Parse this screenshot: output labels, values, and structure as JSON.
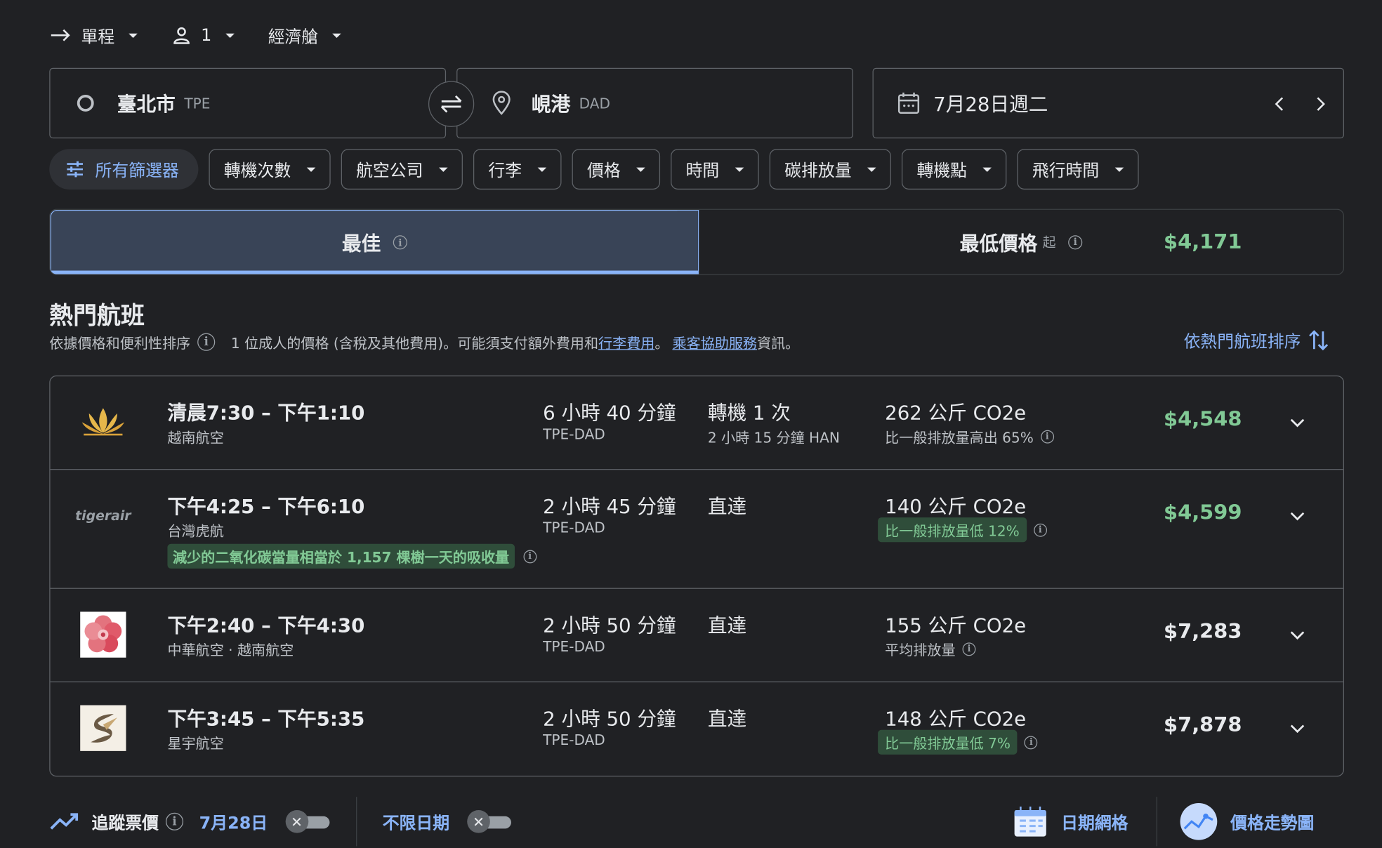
{
  "topbar": {
    "trip_type": "單程",
    "passengers": "1",
    "cabin": "經濟艙"
  },
  "search": {
    "origin_city": "臺北市",
    "origin_code": "TPE",
    "dest_city": "峴港",
    "dest_code": "DAD",
    "date": "7月28日週二"
  },
  "filters": {
    "all": "所有篩選器",
    "chips": [
      "轉機次數",
      "航空公司",
      "行李",
      "價格",
      "時間",
      "碳排放量",
      "轉機點",
      "飛行時間"
    ]
  },
  "tabs": {
    "best": "最佳",
    "cheapest": "最低價格",
    "cheapest_price": "$4,171",
    "cheapest_from": "起"
  },
  "section": {
    "title": "熱門航班",
    "sort_note": "依據價格和便利性排序",
    "price_note": "1 位成人的價格 (含稅及其他費用)。可能須支付額外費用和",
    "baggage_link": "行李費用",
    "sep": "。",
    "assist_link": "乘客協助服務",
    "tail": "資訊。",
    "sort_button": "依熱門航班排序"
  },
  "flights": [
    {
      "times": "清晨7:30 – 下午1:10",
      "airline": "越南航空",
      "duration": "6 小時 40 分鐘",
      "route": "TPE-DAD",
      "stops": "轉機 1 次",
      "layover": "2 小時 15 分鐘 HAN",
      "co2": "262 公斤 CO2e",
      "co2_note": "比一般排放量高出 65%",
      "price": "$4,548",
      "logo": "lotus-logo-icon"
    },
    {
      "times": "下午4:25 – 下午6:10",
      "airline": "台灣虎航",
      "duration": "2 小時 45 分鐘",
      "route": "TPE-DAD",
      "stops": "直達",
      "co2": "140 公斤 CO2e",
      "co2_note": "比一般排放量低 12%",
      "eco_badge": "減少的二氧化碳當量相當於 1,157 棵樹一天的吸收量",
      "price": "$4,599",
      "logo_text": "tigerair"
    },
    {
      "times": "下午2:40 – 下午4:30",
      "airline": "中華航空 · 越南航空",
      "duration": "2 小時 50 分鐘",
      "route": "TPE-DAD",
      "stops": "直達",
      "co2": "155 公斤 CO2e",
      "co2_note": "平均排放量",
      "price": "$7,283",
      "logo": "plum-blossom-logo-icon"
    },
    {
      "times": "下午3:45 – 下午5:35",
      "airline": "星宇航空",
      "duration": "2 小時 50 分鐘",
      "route": "TPE-DAD",
      "stops": "直達",
      "co2": "148 公斤 CO2e",
      "co2_note": "比一般排放量低 7%",
      "price": "$7,878",
      "logo": "starlux-logo-icon"
    }
  ],
  "bottom": {
    "track_label": "追蹤票價",
    "track_date": "7月28日",
    "any_dates": "不限日期",
    "date_grid": "日期網格",
    "price_graph": "價格走勢圖"
  },
  "colors": {
    "background": "#202124",
    "accent_blue": "#8ab4f8",
    "price_green": "#81c995",
    "border": "#5f6368"
  }
}
